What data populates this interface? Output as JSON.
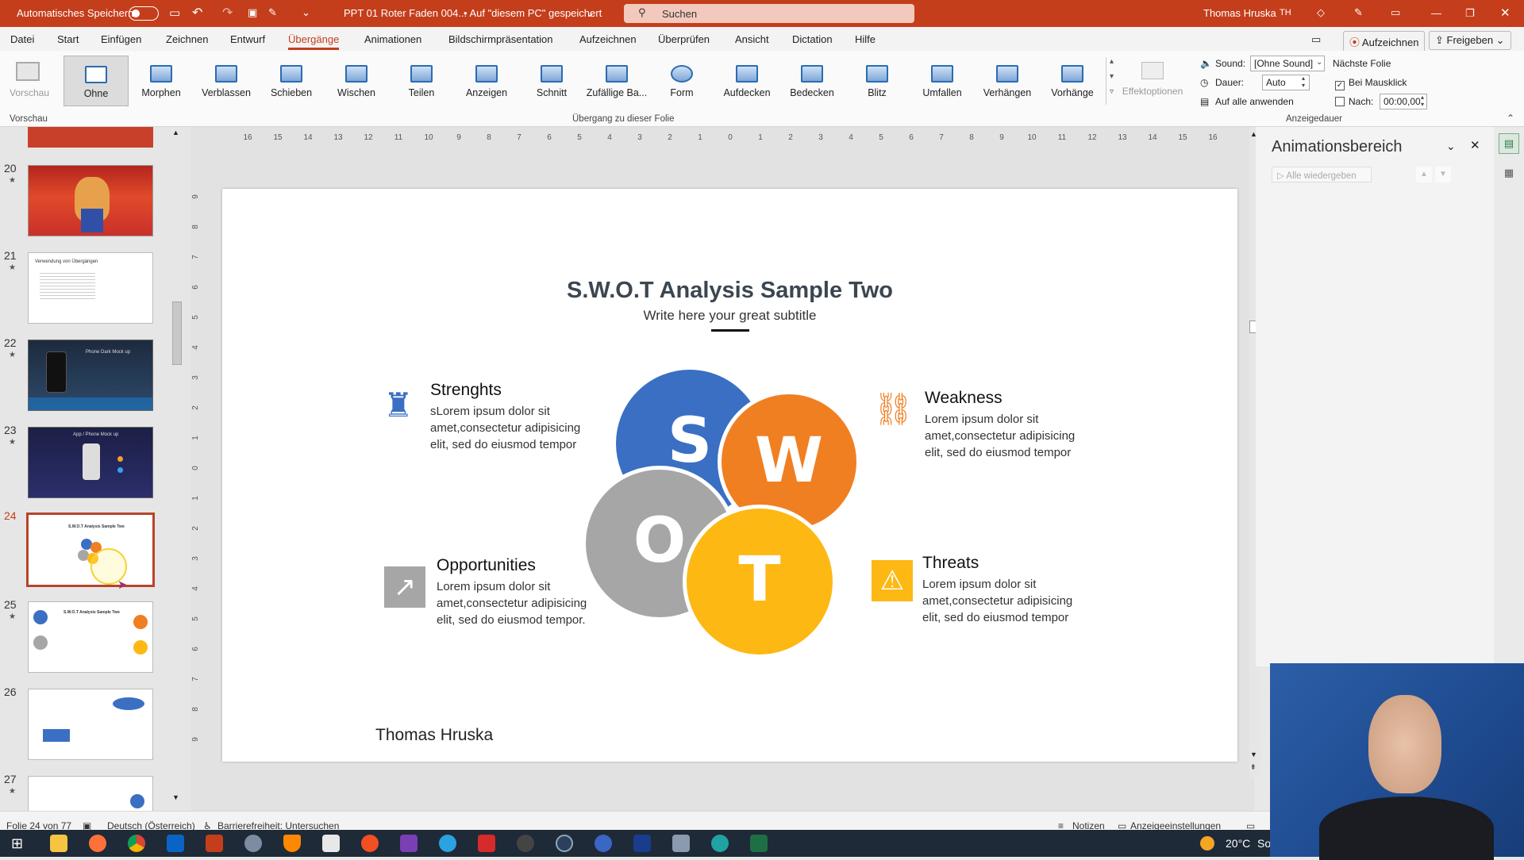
{
  "titlebar": {
    "autosave_label": "Automatisches Speichern",
    "doc_title": "PPT 01 Roter Faden 004...",
    "save_state": "• Auf \"diesem PC\" gespeichert",
    "search_placeholder": "Suchen",
    "user_name": "Thomas Hruska",
    "user_initials": "TH"
  },
  "menu": {
    "items": [
      "Datei",
      "Start",
      "Einfügen",
      "Zeichnen",
      "Entwurf",
      "Übergänge",
      "Animationen",
      "Bildschirmpräsentation",
      "Aufzeichnen",
      "Überprüfen",
      "Ansicht",
      "Dictation",
      "Hilfe"
    ],
    "active": "Übergänge",
    "record_button": "Aufzeichnen",
    "share_button": "Freigeben"
  },
  "ribbon": {
    "preview_label": "Vorschau",
    "preview_group": "Vorschau",
    "transitions": [
      "Ohne",
      "Morphen",
      "Verblassen",
      "Schieben",
      "Wischen",
      "Teilen",
      "Anzeigen",
      "Schnitt",
      "Zufällige Ba...",
      "Form",
      "Aufdecken",
      "Bedecken",
      "Blitz",
      "Umfallen",
      "Verhängen",
      "Vorhänge"
    ],
    "selected_transition": "Ohne",
    "transition_group": "Übergang zu dieser Folie",
    "effect_options": "Effektoptionen",
    "sound_label": "Sound:",
    "sound_value": "[Ohne Sound]",
    "duration_label": "Dauer:",
    "duration_value": "Auto",
    "apply_all": "Auf alle anwenden",
    "next_slide_label": "Nächste Folie",
    "on_click_label": "Bei Mausklick",
    "on_click_checked": "✓",
    "after_label": "Nach:",
    "after_value": "00:00,00",
    "timing_group": "Anzeigedauer"
  },
  "thumbnails": [
    {
      "number": "20",
      "star": "★"
    },
    {
      "number": "21",
      "star": "★",
      "text": "Verwendung von Übergängen"
    },
    {
      "number": "22",
      "star": "★",
      "text": "Phone Dark Mock up"
    },
    {
      "number": "23",
      "star": "★",
      "text": "App / Phone Mock up"
    },
    {
      "number": "24",
      "star": "",
      "text": "S.W.O.T Analysis Sample Two"
    },
    {
      "number": "25",
      "star": "★",
      "text": "S.W.O.T Analysis Sample Two"
    },
    {
      "number": "26",
      "star": ""
    },
    {
      "number": "27",
      "star": "★"
    }
  ],
  "slide": {
    "title": "S.W.O.T Analysis Sample Two",
    "subtitle": "Write here your great subtitle",
    "author": "Thomas Hruska",
    "letters": {
      "s": "S",
      "w": "W",
      "o": "O",
      "t": "T"
    },
    "colors": {
      "s": "#3a6fc4",
      "w": "#f07f22",
      "o": "#a6a6a6",
      "t": "#fdb813"
    },
    "sections": {
      "strengths": {
        "title": "Strenghts",
        "body": "sLorem ipsum dolor sit amet,consectetur adipisicing elit, sed do eiusmod tempor"
      },
      "weakness": {
        "title": "Weakness",
        "body": "Lorem ipsum dolor sit amet,consectetur adipisicing elit, sed do eiusmod tempor"
      },
      "opportunities": {
        "title": "Opportunities",
        "body": "Lorem ipsum dolor sit amet,consectetur adipisicing elit, sed do eiusmod tempor."
      },
      "threats": {
        "title": "Threats",
        "body": "Lorem ipsum dolor sit amet,consectetur adipisicing elit, sed do eiusmod tempor"
      }
    }
  },
  "anim_pane": {
    "title": "Animationsbereich",
    "play_all": "Alle wiedergeben"
  },
  "statusbar": {
    "slide_count": "Folie 24 von 77",
    "language": "Deutsch (Österreich)",
    "accessibility": "Barrierefreiheit: Untersuchen",
    "notes": "Notizen",
    "display_settings": "Anzeigeeinstellungen"
  },
  "taskbar": {
    "weather": "20°C",
    "weather_extra": "Sor"
  }
}
